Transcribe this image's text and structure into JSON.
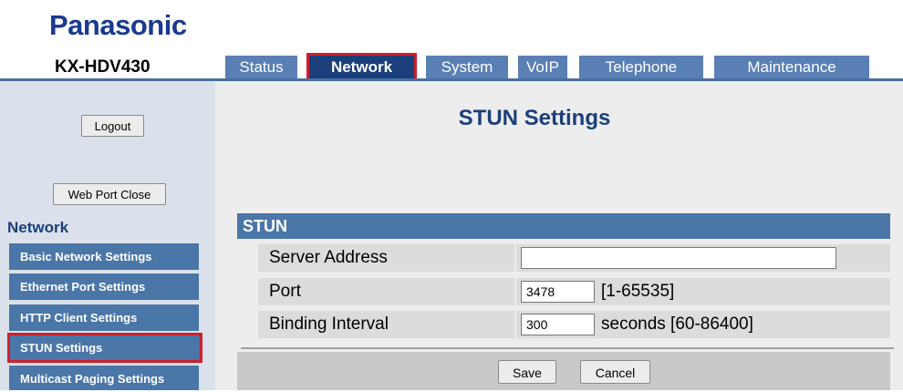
{
  "brand": {
    "logo_text": "Panasonic",
    "model": "KX-HDV430"
  },
  "tabs": [
    {
      "label": "Status"
    },
    {
      "label": "Network"
    },
    {
      "label": "System"
    },
    {
      "label": "VoIP"
    },
    {
      "label": "Telephone"
    },
    {
      "label": "Maintenance"
    }
  ],
  "active_tab": "Network",
  "sidebar": {
    "logout_label": "Logout",
    "web_port_close_label": "Web Port Close",
    "section_title": "Network",
    "items": [
      {
        "label": "Basic Network Settings"
      },
      {
        "label": "Ethernet Port Settings"
      },
      {
        "label": "HTTP Client Settings"
      },
      {
        "label": "STUN Settings"
      },
      {
        "label": "Multicast Paging Settings"
      }
    ],
    "selected_item": "STUN Settings"
  },
  "page": {
    "title": "STUN Settings",
    "section_header": "STUN",
    "fields": [
      {
        "label": "Server Address",
        "value": "",
        "hint": ""
      },
      {
        "label": "Port",
        "value": "3478",
        "hint": "[1-65535]"
      },
      {
        "label": "Binding Interval",
        "value": "300",
        "hint": "seconds [60-86400]"
      }
    ]
  },
  "footer": {
    "save_label": "Save",
    "cancel_label": "Cancel"
  },
  "colors": {
    "brand_blue": "#1a3a8f",
    "tab_blue": "#5a7fb4",
    "tab_active": "#1a3f7a",
    "section_blue": "#4a76a8",
    "highlight_red": "#d0202c"
  }
}
